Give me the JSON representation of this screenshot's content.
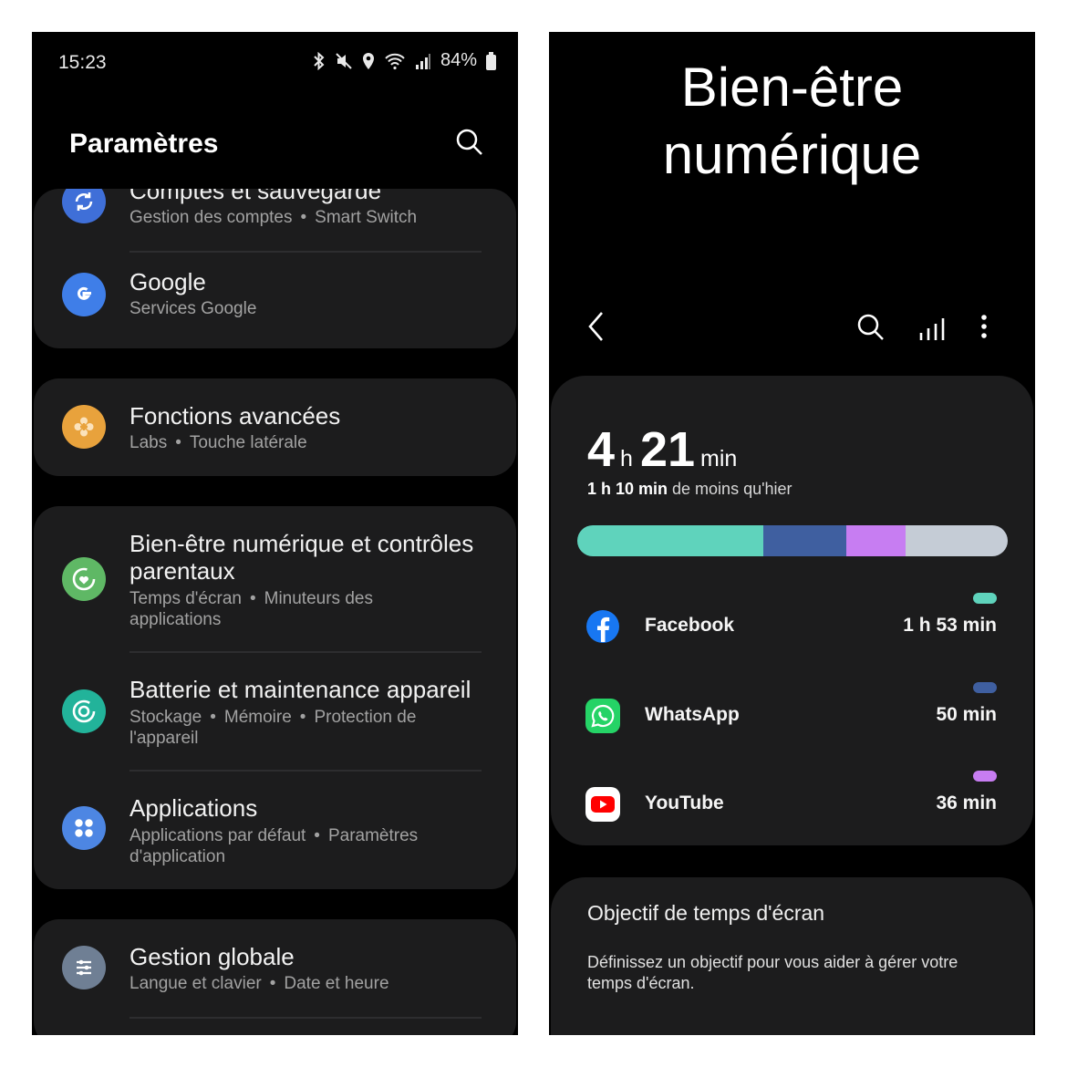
{
  "left": {
    "status": {
      "time": "15:23",
      "battery": "84%"
    },
    "title": "Paramètres",
    "items": [
      {
        "title": "Comptes et sauvegarde",
        "sub": [
          "Gestion des comptes",
          "Smart Switch"
        ],
        "color": "#3f6fd8"
      },
      {
        "title": "Google",
        "sub": [
          "Services Google"
        ],
        "color": "#3f7ee8"
      },
      {
        "title": "Fonctions avancées",
        "sub": [
          "Labs",
          "Touche latérale"
        ],
        "color": "#e8a23c"
      },
      {
        "title": "Bien-être numérique et contrôles parentaux",
        "sub": [
          "Temps d'écran",
          "Minuteurs des applications"
        ],
        "color": "#5fb865"
      },
      {
        "title": "Batterie et maintenance appareil",
        "sub": [
          "Stockage",
          "Mémoire",
          "Protection de l'appareil"
        ],
        "color": "#22b39a"
      },
      {
        "title": "Applications",
        "sub": [
          "Applications par défaut",
          "Paramètres d'application"
        ],
        "color": "#4d86e3"
      },
      {
        "title": "Gestion globale",
        "sub": [
          "Langue et clavier",
          "Date et heure"
        ],
        "color": "#6f7f94"
      }
    ],
    "separator": "•"
  },
  "right": {
    "title_line1": "Bien-être",
    "title_line2": "numérique",
    "usage": {
      "hours": "4",
      "hours_unit": "h",
      "minutes": "21",
      "minutes_unit": "min",
      "compare_bold": "1 h 10 min",
      "compare_rest": " de moins qu'hier"
    },
    "apps": [
      {
        "name": "Facebook",
        "time": "1 h 53 min",
        "color": "#5fd3bc",
        "minutes": 113
      },
      {
        "name": "WhatsApp",
        "time": "50 min",
        "color": "#3f5fa0",
        "minutes": 50
      },
      {
        "name": "YouTube",
        "time": "36 min",
        "color": "#c77df2",
        "minutes": 36
      }
    ],
    "bar_other_color": "#c5ccd6",
    "bar_total_minutes": 261,
    "goal": {
      "title": "Objectif de temps d'écran",
      "desc": "Définissez un objectif pour vous aider à gérer votre temps d'écran."
    }
  }
}
